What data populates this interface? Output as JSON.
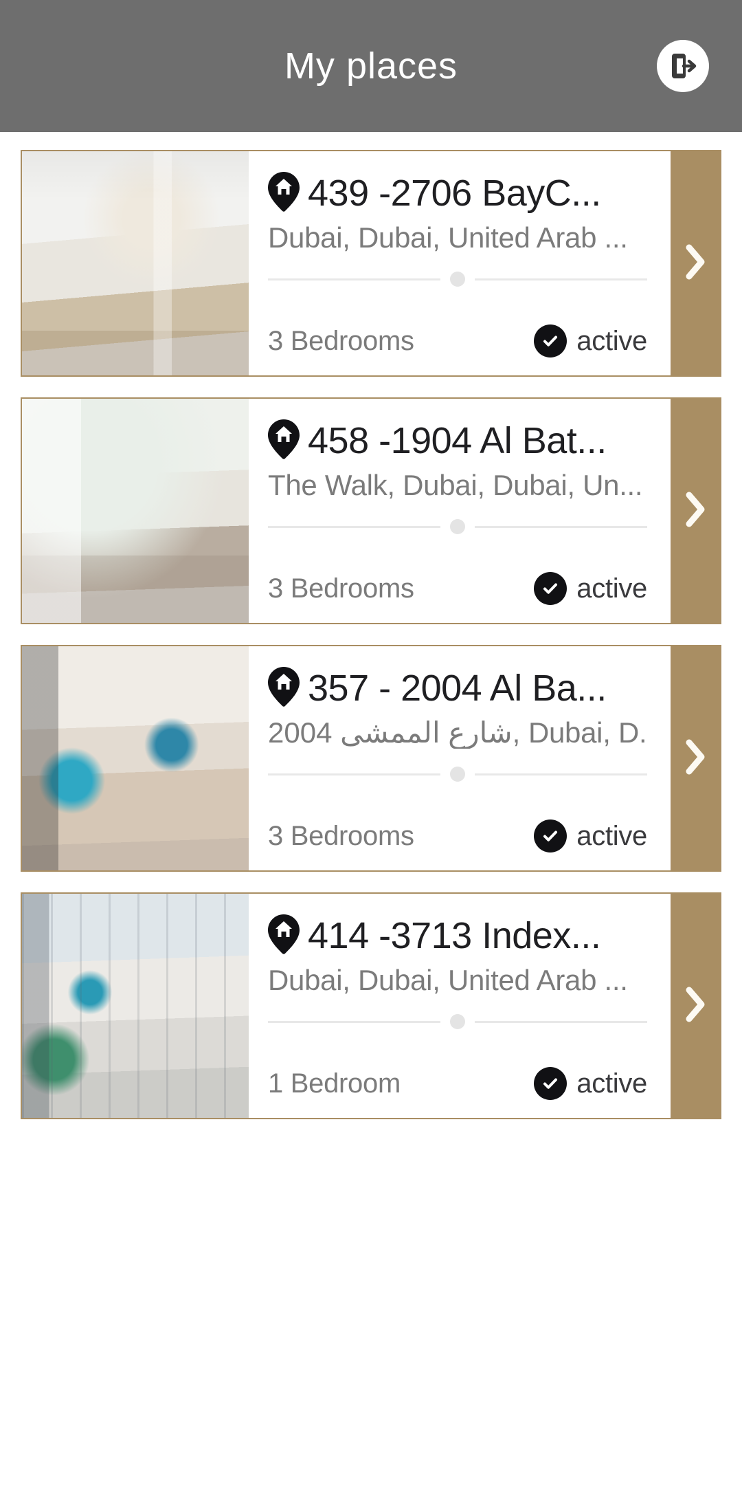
{
  "header": {
    "title": "My places",
    "logout_icon": "logout-icon",
    "background_color": "#6e6e6e",
    "text_color": "#ffffff"
  },
  "theme": {
    "accent_gold": "#a98e63",
    "card_background": "#ffffff",
    "title_color": "#1f1f22",
    "subtitle_color": "#7b7b7b",
    "badge_color": "#111114"
  },
  "list": {
    "items": [
      {
        "pin_icon": "home-pin-icon",
        "title": "439 -2706 BayC...",
        "subtitle": "Dubai, Dubai, United Arab ...",
        "bedrooms": "3 Bedrooms",
        "status": "active",
        "status_icon": "check-circle-icon",
        "chevron_icon": "chevron-right-icon",
        "thumb_class": "thumb-1"
      },
      {
        "pin_icon": "home-pin-icon",
        "title": "458 -1904 Al Bat...",
        "subtitle": "The Walk, Dubai, Dubai, Un...",
        "bedrooms": "3 Bedrooms",
        "status": "active",
        "status_icon": "check-circle-icon",
        "chevron_icon": "chevron-right-icon",
        "thumb_class": "thumb-2"
      },
      {
        "pin_icon": "home-pin-icon",
        "title": "357 - 2004 Al Ba...",
        "subtitle": "2004 شارع الممشى, Dubai, D...",
        "bedrooms": "3 Bedrooms",
        "status": "active",
        "status_icon": "check-circle-icon",
        "chevron_icon": "chevron-right-icon",
        "thumb_class": "thumb-3"
      },
      {
        "pin_icon": "home-pin-icon",
        "title": "414 -3713 Index...",
        "subtitle": "Dubai, Dubai, United Arab ...",
        "bedrooms": "1 Bedroom",
        "status": "active",
        "status_icon": "check-circle-icon",
        "chevron_icon": "chevron-right-icon",
        "thumb_class": "thumb-4"
      }
    ]
  }
}
